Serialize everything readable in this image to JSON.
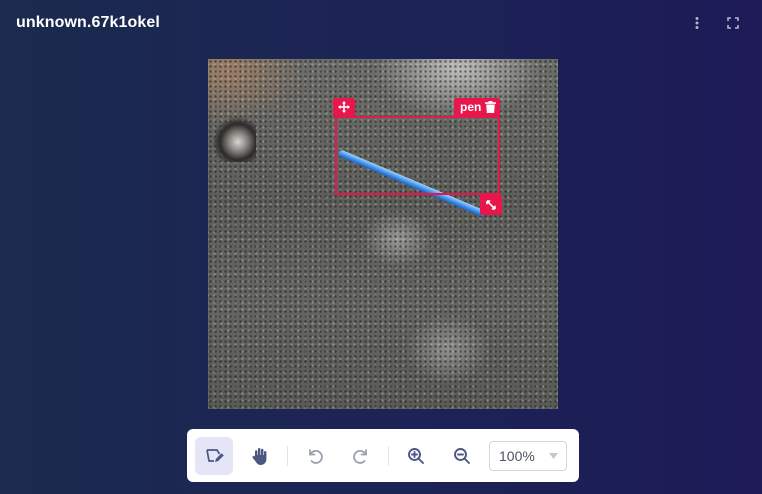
{
  "header": {
    "title": "unknown.67k1okel",
    "icons": [
      "more-vertical-icon",
      "fullscreen-icon"
    ]
  },
  "annotation": {
    "label": "pen",
    "color": "#e8174b",
    "icons": [
      "move-icon",
      "trash-icon",
      "resize-icon"
    ]
  },
  "toolbar": {
    "tools": [
      "draw-box-icon",
      "pan-hand-icon",
      "undo-icon",
      "redo-icon",
      "zoom-in-icon",
      "zoom-out-icon"
    ],
    "active_tool": "draw-box-icon",
    "zoom_value": "100%"
  },
  "colors": {
    "accent": "#e8174b",
    "icon": "#4b5782",
    "active_bg": "#e4e6f7",
    "background_start": "#1b2a4e",
    "background_end": "#1d1a57"
  }
}
